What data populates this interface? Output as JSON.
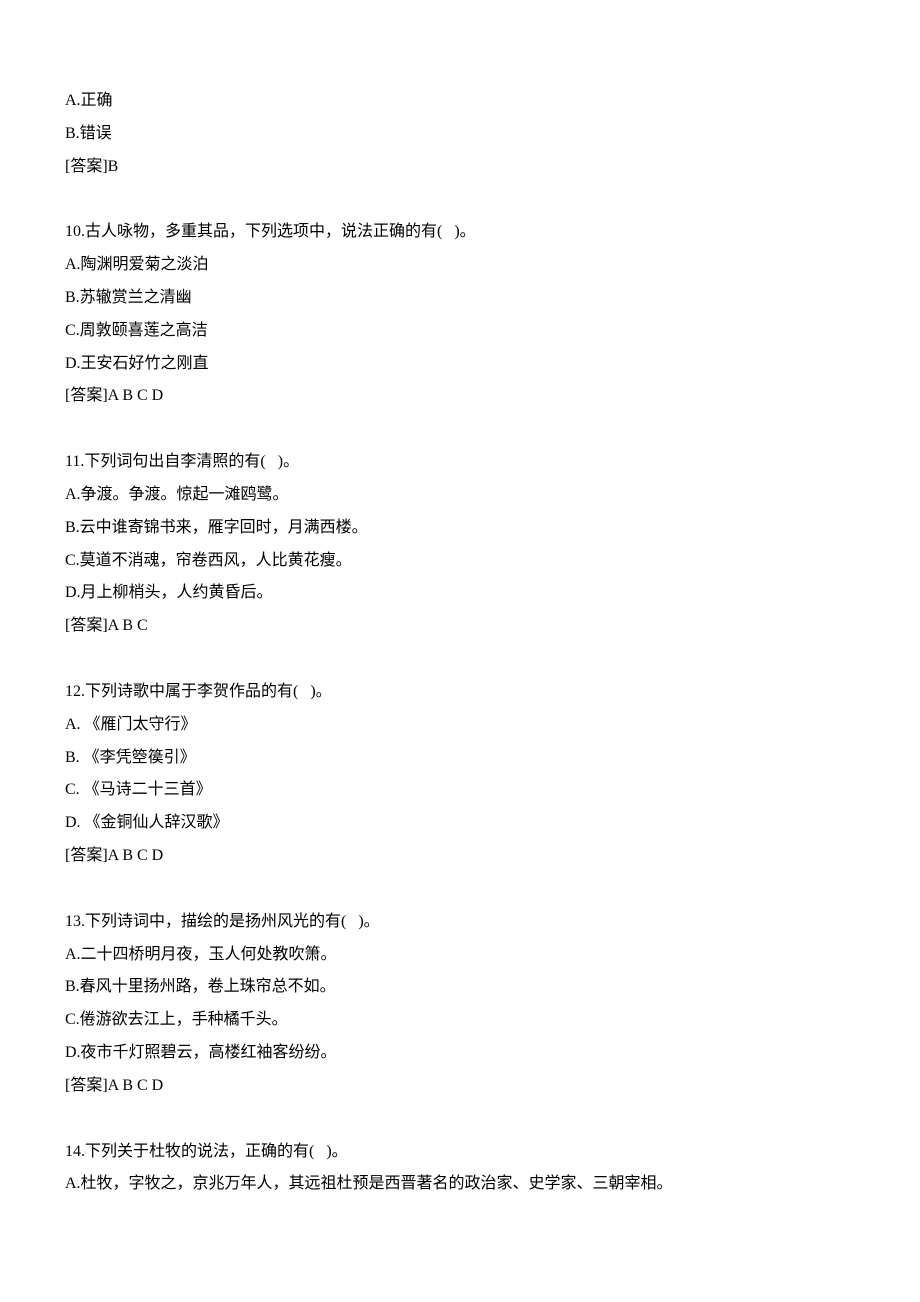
{
  "blocks": [
    {
      "lines": [
        "A.正确",
        "B.错误",
        "[答案]B"
      ]
    },
    {
      "lines": [
        "10.古人咏物，多重其品，下列选项中，说法正确的有(   )。",
        "A.陶渊明爱菊之淡泊",
        "B.苏辙赏兰之清幽",
        "C.周敦颐喜莲之高洁",
        "D.王安石好竹之刚直",
        "[答案]A B C D"
      ]
    },
    {
      "lines": [
        "11.下列词句出自李清照的有(   )。",
        "A.争渡。争渡。惊起一滩鸥鹭。",
        "B.云中谁寄锦书来，雁字回时，月满西楼。",
        "C.莫道不消魂，帘卷西风，人比黄花瘦。",
        "D.月上柳梢头，人约黄昏后。",
        "[答案]A B C"
      ]
    },
    {
      "lines": [
        "12.下列诗歌中属于李贺作品的有(   )。",
        "A. 《雁门太守行》",
        "B. 《李凭箜篌引》",
        "C. 《马诗二十三首》",
        "D. 《金铜仙人辞汉歌》",
        "[答案]A B C D"
      ]
    },
    {
      "lines": [
        "13.下列诗词中，描绘的是扬州风光的有(   )。",
        "A.二十四桥明月夜，玉人何处教吹箫。",
        "B.春风十里扬州路，卷上珠帘总不如。",
        "C.倦游欲去江上，手种橘千头。",
        "D.夜市千灯照碧云，高楼红袖客纷纷。",
        "[答案]A B C D"
      ]
    },
    {
      "lines": [
        "14.下列关于杜牧的说法，正确的有(   )。",
        "A.杜牧，字牧之，京兆万年人，其远祖杜预是西晋著名的政治家、史学家、三朝宰相。"
      ]
    }
  ]
}
